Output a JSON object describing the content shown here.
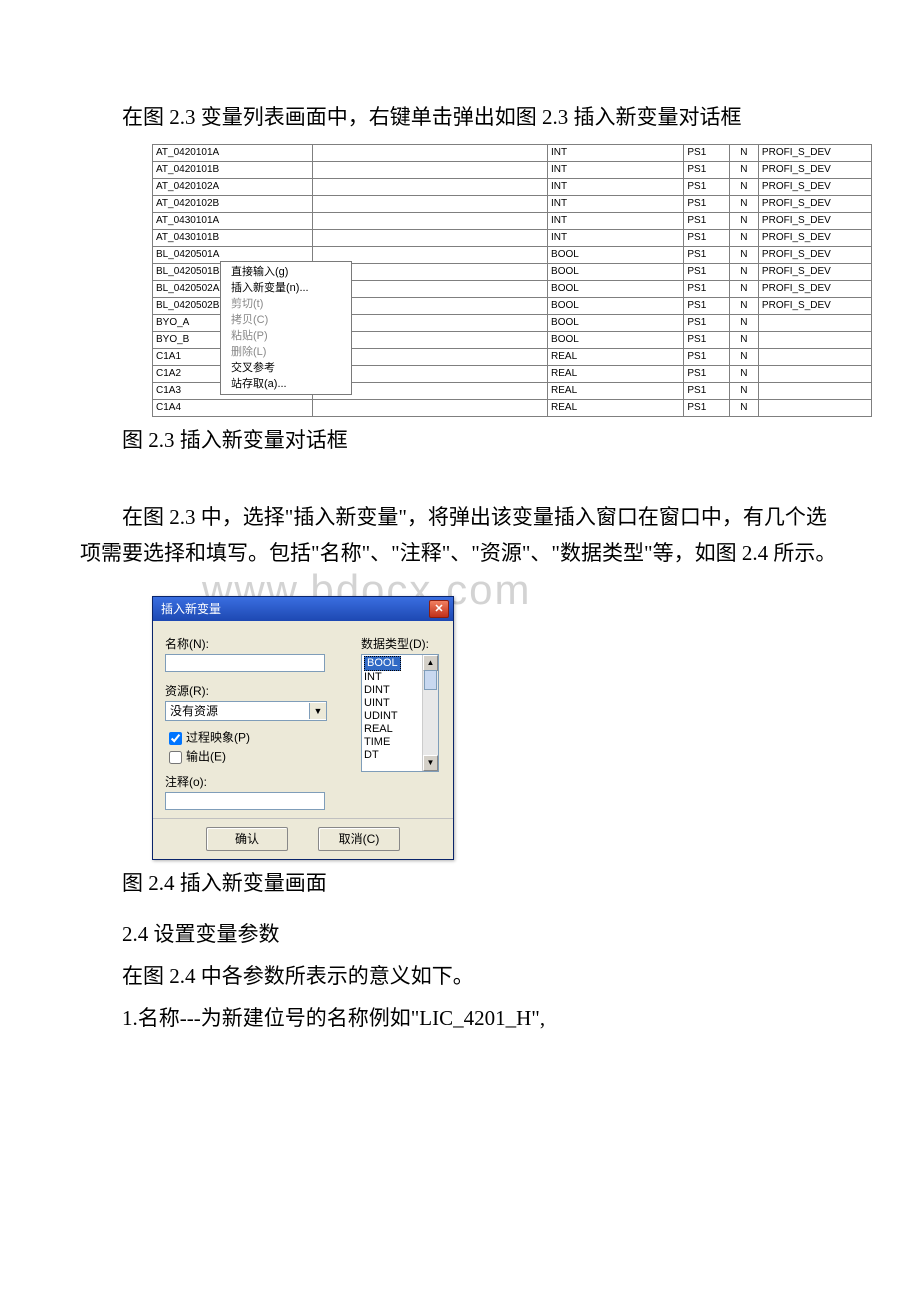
{
  "text": {
    "p1": "在图 2.3 变量列表画面中，右键单击弹出如图 2.3 插入新变量对话框",
    "cap1": "图 2.3 插入新变量对话框",
    "p2": "在图 2.3 中，选择\"插入新变量\"，将弹出该变量插入窗口在窗口中，有几个选项需要选择和填写。包括\"名称\"、\"注释\"、\"资源\"、\"数据类型\"等，如图 2.4 所示。",
    "cap2": "图 2.4 插入新变量画面",
    "sec24": "2.4 设置变量参数",
    "p3": "在图 2.4 中各参数所表示的意义如下。",
    "p4": "1.名称---为新建位号的名称例如\"LIC_4201_H\","
  },
  "watermark": "www.bdocx.com",
  "table": {
    "rows": [
      {
        "c1": "AT_0420101A",
        "c2": "",
        "c3": "INT",
        "c4": "PS1",
        "c5": "N",
        "c6": "PROFI_S_DEV"
      },
      {
        "c1": "AT_0420101B",
        "c2": "",
        "c3": "INT",
        "c4": "PS1",
        "c5": "N",
        "c6": "PROFI_S_DEV"
      },
      {
        "c1": "AT_0420102A",
        "c2": "",
        "c3": "INT",
        "c4": "PS1",
        "c5": "N",
        "c6": "PROFI_S_DEV"
      },
      {
        "c1": "AT_0420102B",
        "c2": "",
        "c3": "INT",
        "c4": "PS1",
        "c5": "N",
        "c6": "PROFI_S_DEV"
      },
      {
        "c1": "AT_0430101A",
        "c2": "",
        "c3": "INT",
        "c4": "PS1",
        "c5": "N",
        "c6": "PROFI_S_DEV"
      },
      {
        "c1": "AT_0430101B",
        "c2": "",
        "c3": "INT",
        "c4": "PS1",
        "c5": "N",
        "c6": "PROFI_S_DEV"
      },
      {
        "c1": "BL_0420501A",
        "c2": "",
        "c3": "BOOL",
        "c4": "PS1",
        "c5": "N",
        "c6": "PROFI_S_DEV"
      },
      {
        "c1": "BL_0420501B",
        "c2": "",
        "c3": "BOOL",
        "c4": "PS1",
        "c5": "N",
        "c6": "PROFI_S_DEV"
      },
      {
        "c1": "BL_0420502A",
        "c2": "",
        "c3": "BOOL",
        "c4": "PS1",
        "c5": "N",
        "c6": "PROFI_S_DEV"
      },
      {
        "c1": "BL_0420502B",
        "c2": "",
        "c3": "BOOL",
        "c4": "PS1",
        "c5": "N",
        "c6": "PROFI_S_DEV"
      },
      {
        "c1": "BYO_A",
        "c2": "",
        "c3": "BOOL",
        "c4": "PS1",
        "c5": "N",
        "c6": ""
      },
      {
        "c1": "BYO_B",
        "c2": "",
        "c3": "BOOL",
        "c4": "PS1",
        "c5": "N",
        "c6": ""
      },
      {
        "c1": "C1A1",
        "c2": "",
        "c3": "REAL",
        "c4": "PS1",
        "c5": "N",
        "c6": ""
      },
      {
        "c1": "C1A2",
        "c2": "",
        "c3": "REAL",
        "c4": "PS1",
        "c5": "N",
        "c6": ""
      },
      {
        "c1": "C1A3",
        "c2": "",
        "c3": "REAL",
        "c4": "PS1",
        "c5": "N",
        "c6": ""
      },
      {
        "c1": "C1A4",
        "c2": "",
        "c3": "REAL",
        "c4": "PS1",
        "c5": "N",
        "c6": ""
      }
    ]
  },
  "context_menu": {
    "items": [
      {
        "label": "直接输入(g)",
        "disabled": false
      },
      {
        "label": "插入新变量(n)...",
        "disabled": false
      },
      {
        "label": "剪切(t)",
        "disabled": true
      },
      {
        "label": "拷贝(C)",
        "disabled": true
      },
      {
        "label": "粘贴(P)",
        "disabled": true
      },
      {
        "label": "删除(L)",
        "disabled": true
      },
      {
        "label": "交叉参考",
        "disabled": false
      },
      {
        "label": "站存取(a)...",
        "disabled": false
      }
    ]
  },
  "dialog": {
    "title": "插入新变量",
    "name_label": "名称(N):",
    "resource_label": "资源(R):",
    "resource_value": "没有资源",
    "chk_process_image": "过程映象(P)",
    "chk_output": "输出(E)",
    "comment_label": "注释(o):",
    "datatype_label": "数据类型(D):",
    "types": [
      "BOOL",
      "INT",
      "DINT",
      "UINT",
      "UDINT",
      "REAL",
      "TIME",
      "DT"
    ],
    "ok_label": "确认",
    "cancel_label": "取消(C)"
  }
}
